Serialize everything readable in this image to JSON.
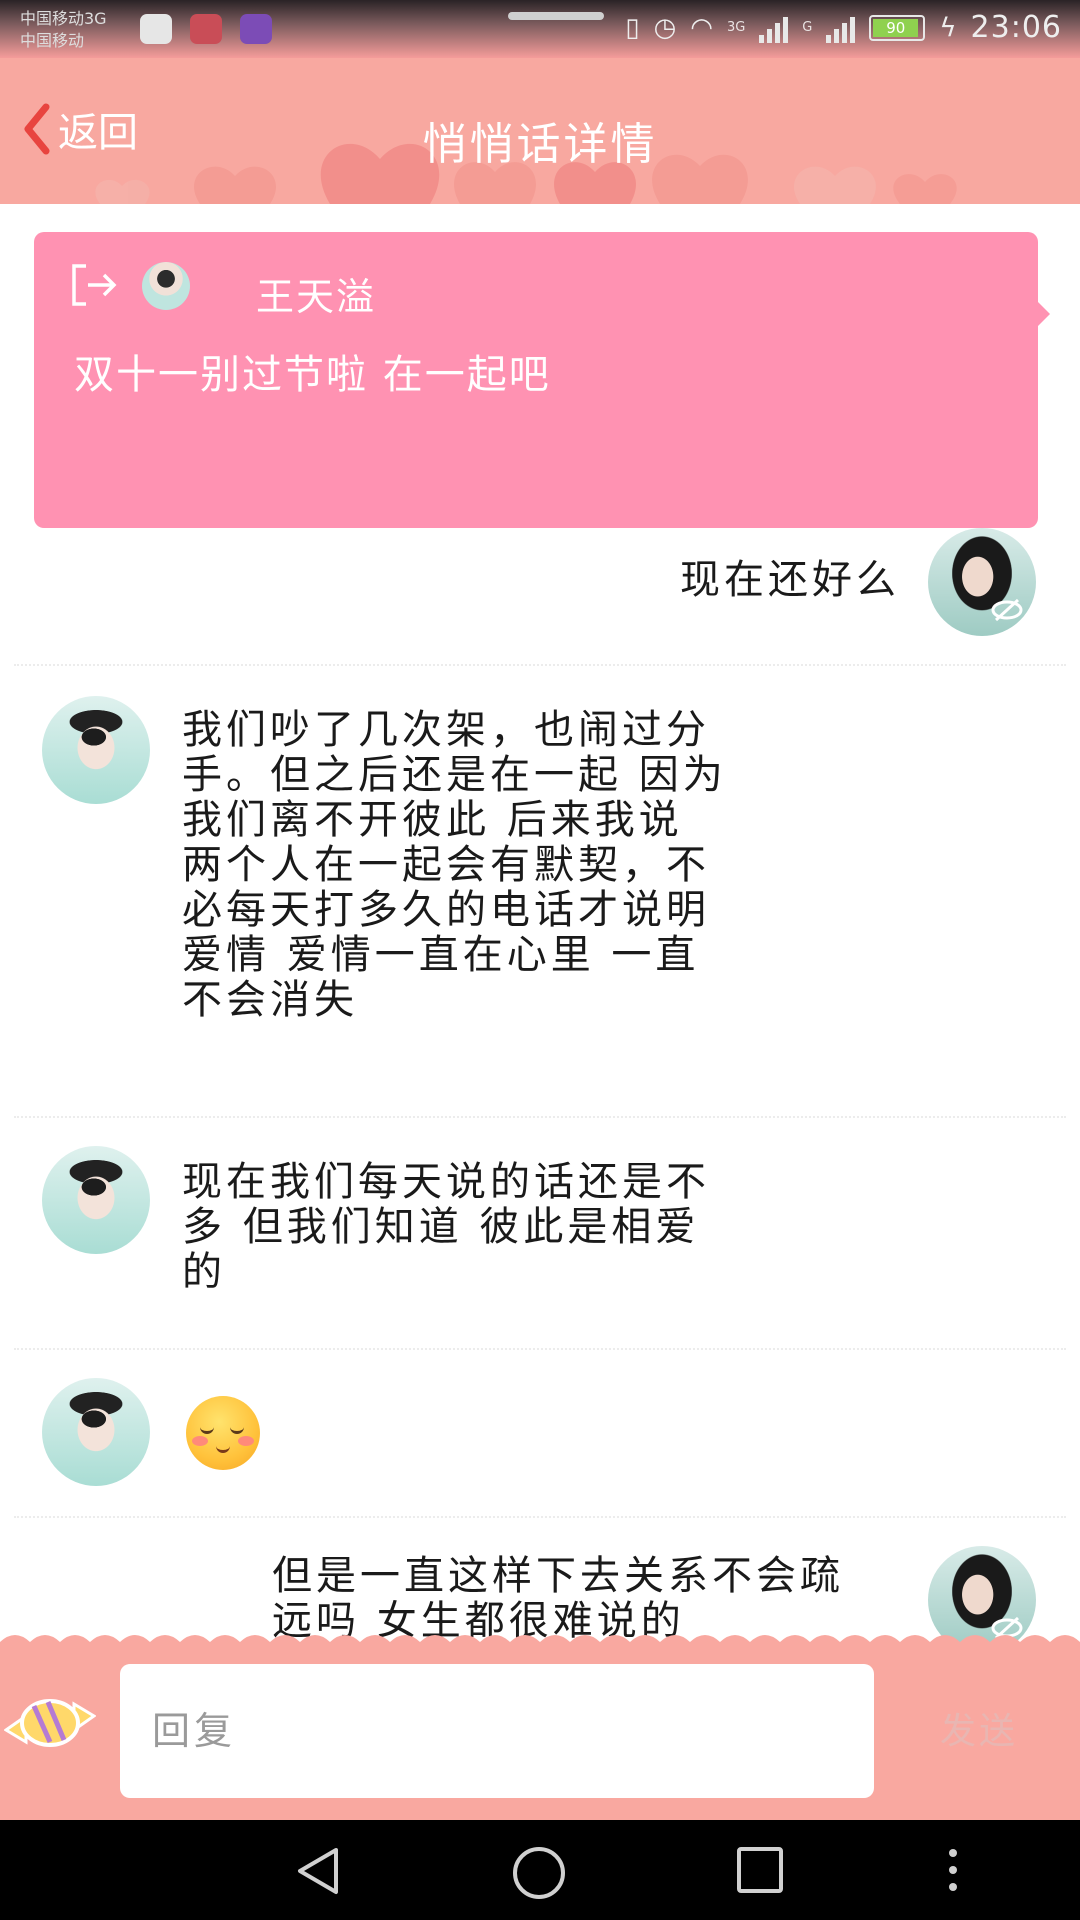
{
  "status_bar": {
    "carrier_line1": "中国移动3G",
    "carrier_line2": "中国移动",
    "net1": "3G",
    "net2": "G",
    "battery": "90",
    "time": "23:06"
  },
  "header": {
    "back_label": "返回",
    "title": "悄悄话详情"
  },
  "whisper_card": {
    "sender_name": "王天溢",
    "content": "双十一别过节啦 在一起吧",
    "background_color": "#ff92b2"
  },
  "messages": [
    {
      "side": "right",
      "avatar": "girl-avatar",
      "text": "现在还好么"
    },
    {
      "side": "left",
      "avatar": "boy-avatar",
      "text": "我们吵了几次架，也闹过分\n手。但之后还是在一起 因为\n我们离不开彼此 后来我说\n两个人在一起会有默契，不\n必每天打多久的电话才说明\n爱情 爱情一直在心里 一直\n不会消失"
    },
    {
      "side": "left",
      "avatar": "boy-avatar",
      "text": "现在我们每天说的话还是不\n多 但我们知道 彼此是相爱\n的"
    },
    {
      "side": "left",
      "avatar": "boy-avatar",
      "emoji": "blushing-smile-emoji"
    },
    {
      "side": "right",
      "avatar": "girl-avatar",
      "text": "但是一直这样下去关系不会疏\n远吗 女生都很难说的"
    }
  ],
  "reply_bar": {
    "placeholder": "回复",
    "send_label": "发送"
  },
  "icons": {
    "back": "chevron-left-icon",
    "exit": "exit-icon",
    "anonymous": "eye-slash-icon",
    "candy": "candy-icon"
  },
  "colors": {
    "header": "#f8a8a0",
    "accent_pink": "#ff92b2",
    "send_disabled": "#e8b6b2"
  }
}
